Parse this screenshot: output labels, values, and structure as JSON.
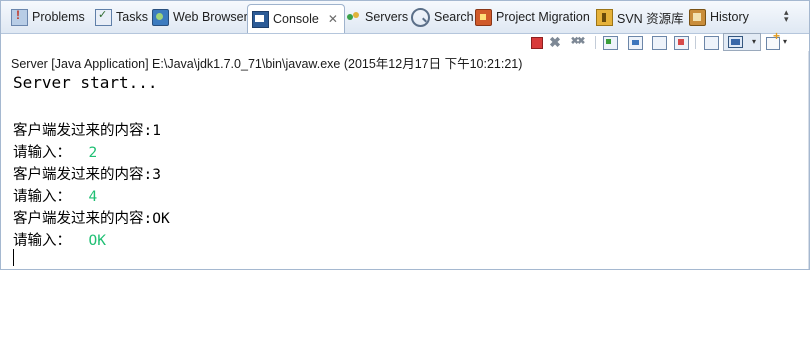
{
  "tabs": [
    {
      "key": "problems",
      "label": "Problems",
      "icon": "problems-icon"
    },
    {
      "key": "tasks",
      "label": "Tasks",
      "icon": "tasks-icon"
    },
    {
      "key": "web_browser",
      "label": "Web Browser",
      "icon": "web-browser-icon"
    },
    {
      "key": "console",
      "label": "Console",
      "icon": "console-icon",
      "active": true
    },
    {
      "key": "servers",
      "label": "Servers",
      "icon": "servers-icon"
    },
    {
      "key": "search",
      "label": "Search",
      "icon": "search-icon"
    },
    {
      "key": "project_migration",
      "label": "Project Migration",
      "icon": "project-migration-icon"
    },
    {
      "key": "svn",
      "label": "SVN 资源库",
      "icon": "svn-repository-icon"
    },
    {
      "key": "history",
      "label": "History",
      "icon": "history-icon"
    }
  ],
  "tab_close_glyph": "✕",
  "toolbar": {
    "buttons": [
      "terminate-icon",
      "remove-launch-icon",
      "remove-all-terminated-icon",
      "scroll-lock-icon",
      "show-stdout-icon",
      "show-stderr-icon",
      "pin-console-icon",
      "display-console-icon",
      "new-console-icon",
      "minimize-icon",
      "maximize-icon"
    ],
    "remove_glyph": "✖",
    "remove_all_glyph": "✖✖",
    "dropdown_glyph": "▾"
  },
  "console": {
    "header": "Server [Java Application] E:\\Java\\jdk1.7.0_71\\bin\\javaw.exe (2015年12月17日 下午10:21:21)",
    "start_line": "Server start...",
    "exchanges": [
      {
        "received_label": "客户端发过来的内容:",
        "received_value": "1",
        "prompt": "请输入：",
        "input": "2"
      },
      {
        "received_label": "客户端发过来的内容:",
        "received_value": "3",
        "prompt": "请输入：",
        "input": "4"
      },
      {
        "received_label": "客户端发过来的内容:",
        "received_value": "OK",
        "prompt": "请输入：",
        "input": "OK"
      }
    ]
  },
  "colors": {
    "input_text": "#1fbf73",
    "tab_bar": "#dfe8f3",
    "terminate": "#d83a3a"
  }
}
